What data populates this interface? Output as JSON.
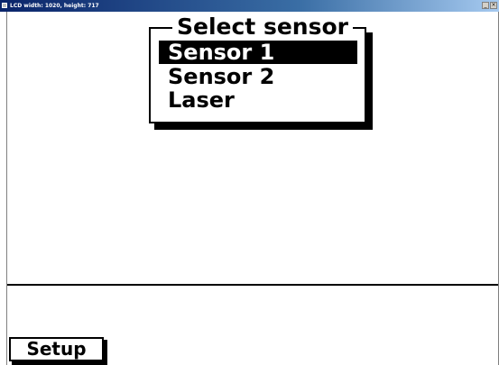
{
  "window": {
    "title": "LCD width: 1020, height: 717"
  },
  "dialog": {
    "title": "Select sensor",
    "items": [
      {
        "label": "Sensor 1",
        "selected": true
      },
      {
        "label": "Sensor 2",
        "selected": false
      },
      {
        "label": "Laser",
        "selected": false
      }
    ]
  },
  "footer": {
    "setup_label": "Setup"
  },
  "colors": {
    "background": "#ffffff",
    "foreground": "#000000",
    "titlebar": "#0a246a"
  }
}
